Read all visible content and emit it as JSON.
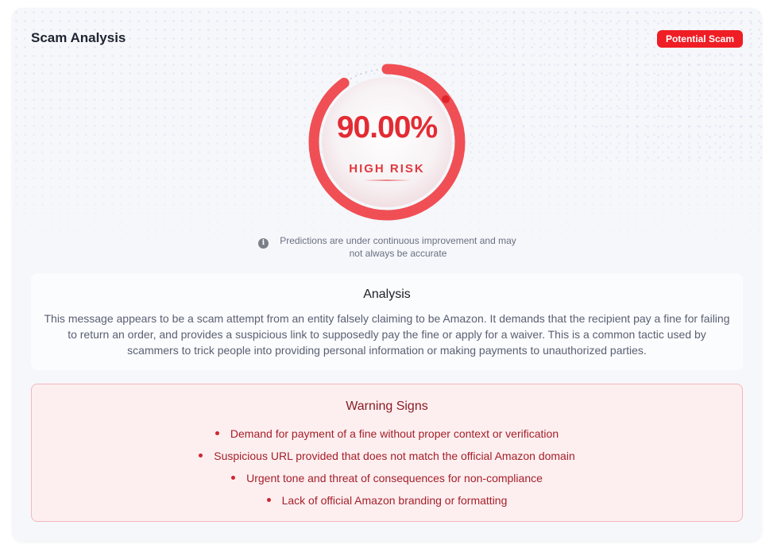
{
  "header": {
    "title": "Scam Analysis",
    "badge": "Potential Scam"
  },
  "gauge": {
    "value_text": "90.00%",
    "value": 90.0,
    "label": "HIGH RISK",
    "color": "#ef4046"
  },
  "note": {
    "icon": "info-icon",
    "text": "Predictions are under continuous improvement and may not always be accurate"
  },
  "analysis": {
    "heading": "Analysis",
    "body": "This message appears to be a scam attempt from an entity falsely claiming to be Amazon. It demands that the recipient pay a fine for failing to return an order, and provides a suspicious link to supposedly pay the fine or apply for a waiver. This is a common tactic used by scammers to trick people into providing personal information or making payments to unauthorized parties."
  },
  "warning": {
    "heading": "Warning Signs",
    "items": [
      "Demand for payment of a fine without proper context or verification",
      "Suspicious URL provided that does not match the official Amazon domain",
      "Urgent tone and threat of consequences for non-compliance",
      "Lack of official Amazon branding or formatting"
    ]
  },
  "colors": {
    "badge": "#ef1d24",
    "danger": "#e32b33",
    "warning_bg": "#fdeff0"
  }
}
